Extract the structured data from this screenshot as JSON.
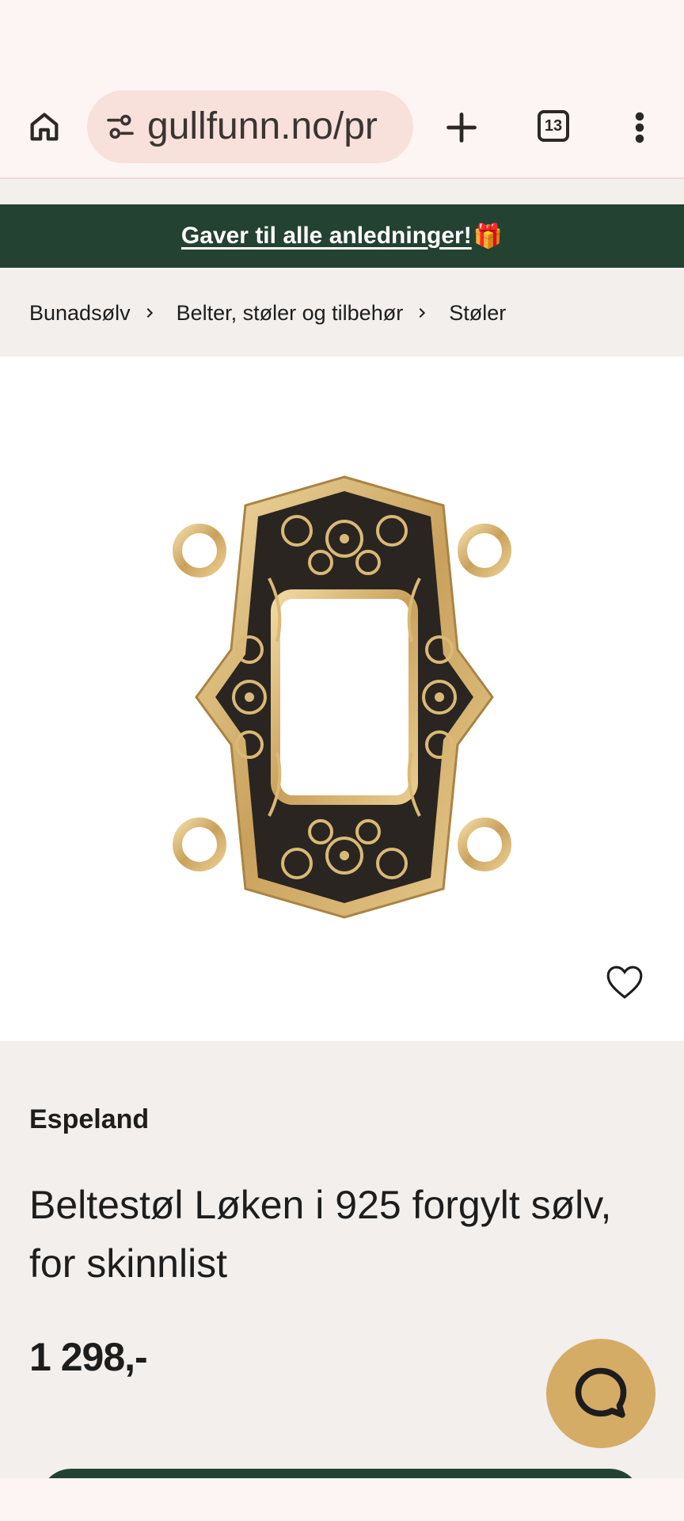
{
  "browser": {
    "url": "gullfunn.no/pr",
    "tab_count": "13"
  },
  "promo": {
    "text": "Gaver til alle anledninger!",
    "emoji": "🎁"
  },
  "breadcrumb": {
    "items": [
      "Bunadsølv",
      "Belter, støler og tilbehør",
      "Støler"
    ]
  },
  "product": {
    "brand": "Espeland",
    "title": "Beltestøl Løken i 925 forgylt sølv, for skinnlist",
    "price": "1 298,-"
  },
  "colors": {
    "promo_bg": "#234232",
    "chat_button": "#d5ac66",
    "info_bg": "#f2efed"
  },
  "icons": [
    "home-icon",
    "tune-icon",
    "plus-icon",
    "tabs-icon",
    "more-vert-icon",
    "chevron-right-icon",
    "heart-icon",
    "chat-icon"
  ]
}
